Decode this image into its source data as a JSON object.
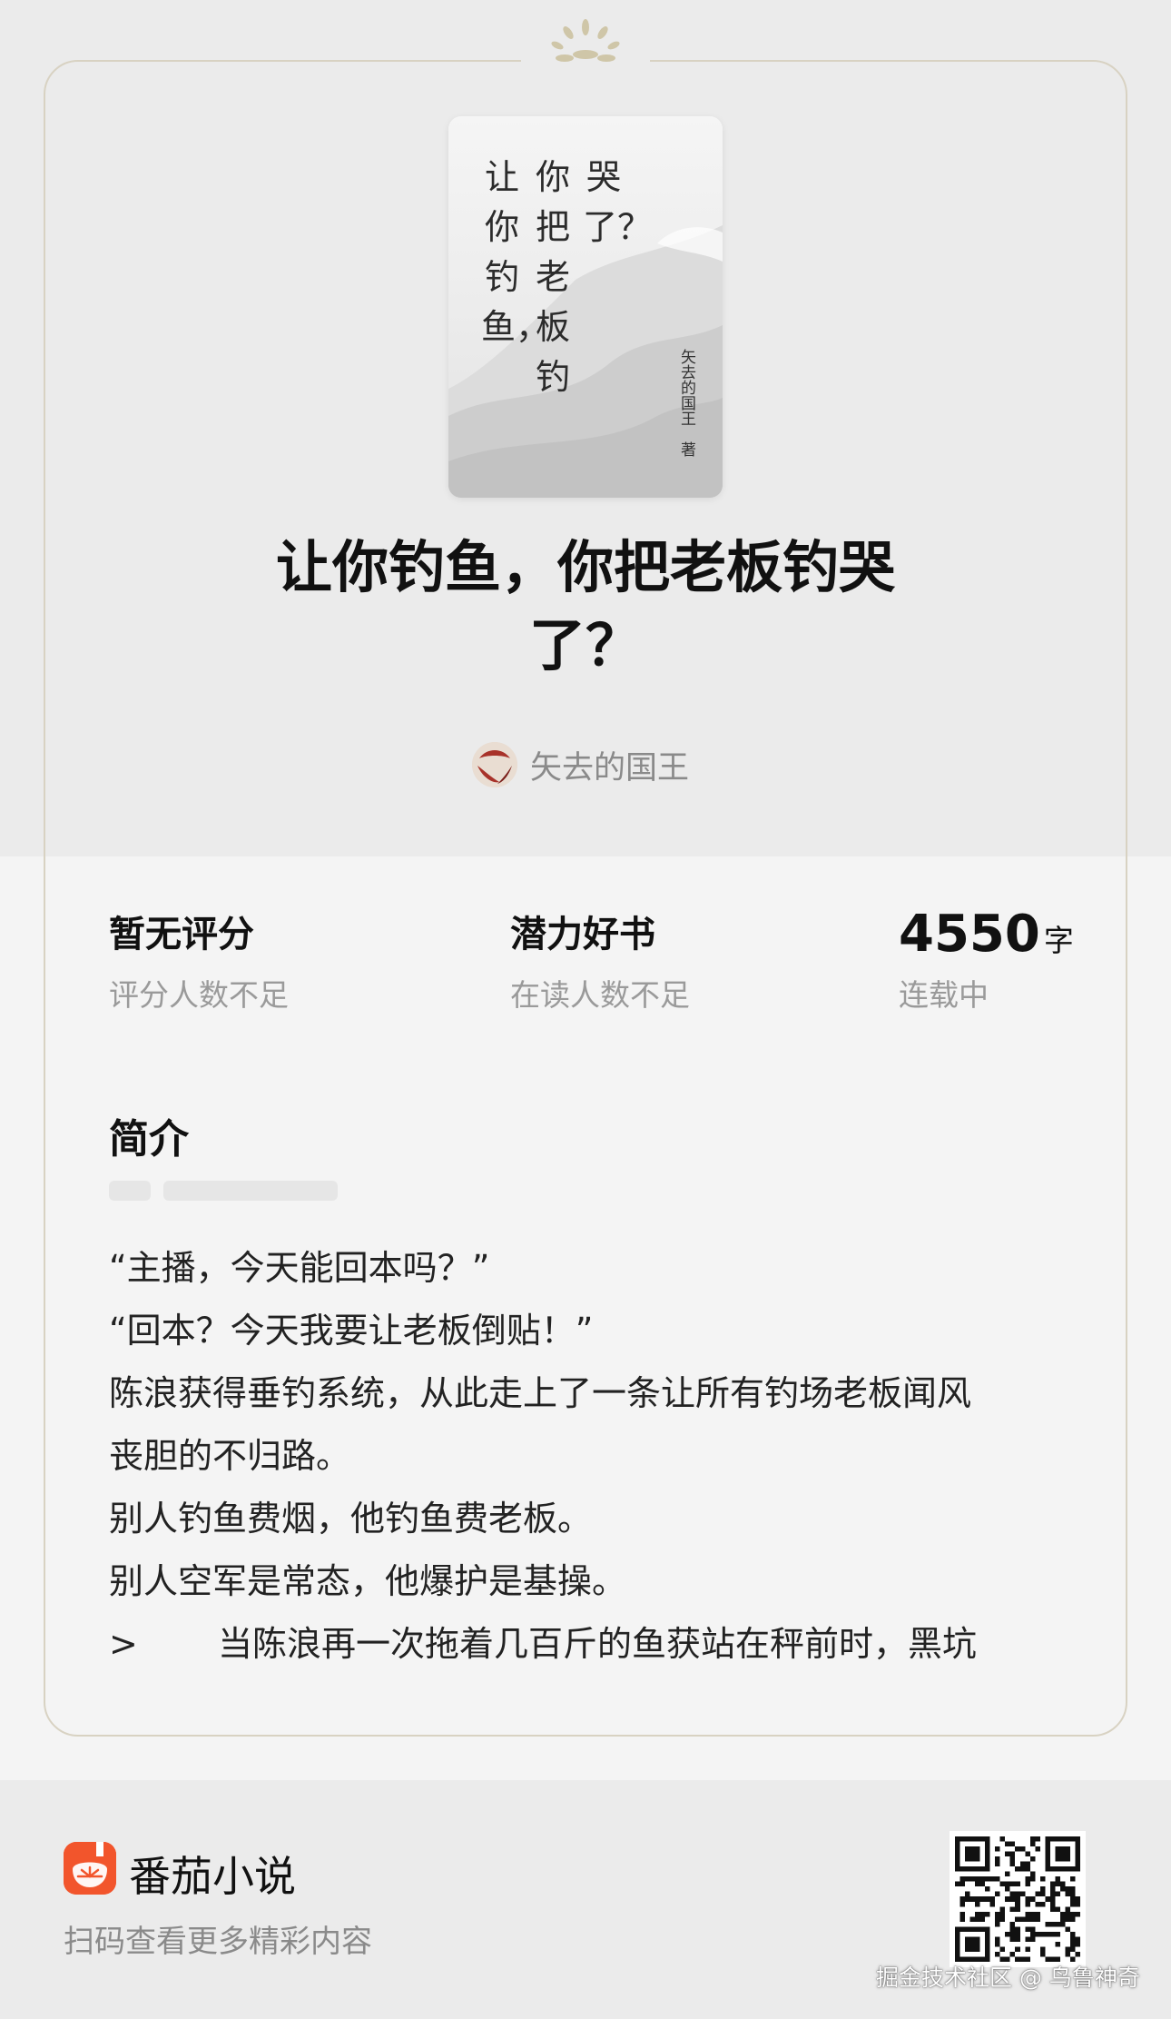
{
  "cover": {
    "columns": [
      "哭了？",
      "你把老板钓",
      "让你钓鱼，"
    ],
    "author_vertical": "矢去的国王　著"
  },
  "book": {
    "title": "让你钓鱼，你把老板钓哭了？",
    "author": "矢去的国王"
  },
  "stats": [
    {
      "main": "暂无评分",
      "sub": "评分人数不足"
    },
    {
      "main": "潜力好书",
      "sub": "在读人数不足"
    },
    {
      "number": "4550",
      "unit": "字",
      "sub": "连载中"
    }
  ],
  "intro": {
    "heading": "简介",
    "lines": [
      "“主播，今天能回本吗？”",
      "“回本？今天我要让老板倒贴！”",
      "陈浪获得垂钓系统，从此走上了一条让所有钓场老板闻风",
      "丧胆的不归路。",
      "别人钓鱼费烟，他钓鱼费老板。",
      "别人空军是常态，他爆护是基操。"
    ],
    "more_symbol": ">",
    "last_line": "当陈浪再一次拖着几百斤的鱼获站在秤前时，黑坑"
  },
  "footer": {
    "app_name": "番茄小说",
    "tagline": "扫码查看更多精彩内容",
    "watermark": "掘金技术社区 @ 鸟鲁神奇"
  },
  "colors": {
    "accent_red": "#f2552c",
    "frame_gold": "#d8d2c2",
    "text_muted": "#8a8a8a"
  }
}
